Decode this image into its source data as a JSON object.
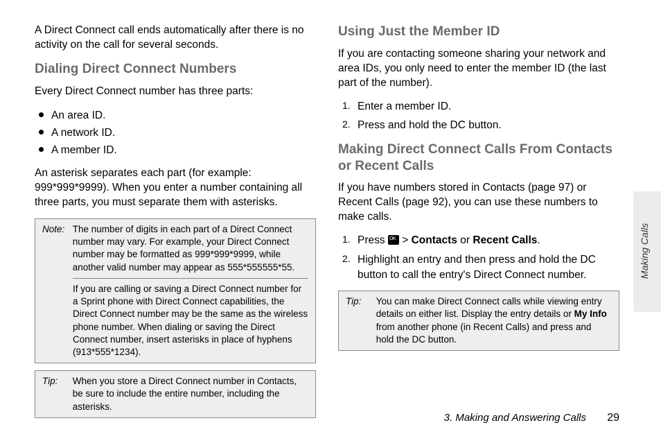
{
  "left": {
    "intro": "A Direct Connect call ends automatically after there is no activity on the call for several seconds.",
    "h1": "Dialing Direct Connect Numbers",
    "p1": "Every Direct Connect number has three parts:",
    "bullets": [
      "An area ID.",
      "A network ID.",
      "A member ID."
    ],
    "p2": "An asterisk separates each part (for example: 999*999*9999). When you enter a number containing all three parts, you must separate them with asterisks.",
    "note": {
      "label": "Note:",
      "text1": "The number of digits in each part of a Direct Connect number may vary. For example, your Direct Connect number may be formatted as 999*999*9999, while another valid number may appear as 555*555555*55.",
      "text2": "If you are calling or saving a Direct Connect number for a Sprint phone with Direct Connect capabilities, the Direct Connect number may be the same as the wireless phone number. When dialing or saving the Direct Connect number, insert asterisks in place of hyphens (913*555*1234)."
    },
    "tip": {
      "label": "Tip:",
      "text": "When you store a Direct Connect number in Contacts, be sure to include the entire number, including the asterisks."
    }
  },
  "right": {
    "h1": "Using Just the Member ID",
    "p1": "If you are contacting someone sharing your network and area IDs, you only need to enter the member ID (the last part of the number).",
    "steps1": [
      "Enter a member ID.",
      "Press and hold the DC button."
    ],
    "h2": "Making Direct Connect Calls From Contacts or Recent Calls",
    "p2": "If you have numbers stored in Contacts (page 97) or Recent Calls (page 92), you can use these numbers to make calls.",
    "step2a_pre": "Press ",
    "step2a_gt": " > ",
    "step2a_contacts": "Contacts",
    "step2a_or": " or ",
    "step2a_recent": "Recent Calls",
    "step2a_post": ".",
    "step2b": "Highlight an entry and then press and hold the DC button to call the entry's Direct Connect number.",
    "tip": {
      "label": "Tip:",
      "pre": "You can make Direct Connect calls while viewing entry details on either list. Display the entry details or ",
      "myinfo": "My Info",
      "post": " from another phone (in Recent Calls) and press and hold the DC button."
    }
  },
  "footer": {
    "chapter": "3. Making and Answering Calls",
    "page": "29"
  },
  "sidetab": "Making Calls"
}
